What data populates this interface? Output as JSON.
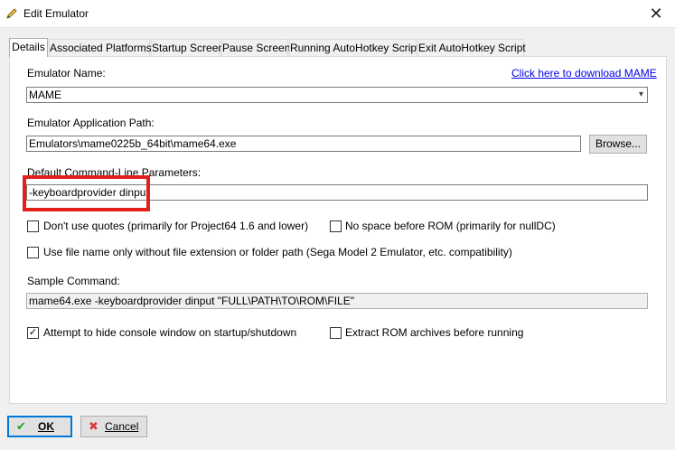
{
  "window": {
    "title": "Edit Emulator",
    "close_glyph": "✕",
    "icon": "pencil-icon"
  },
  "tabs": [
    {
      "label": "Details",
      "active": true
    },
    {
      "label": "Associated Platforms",
      "active": false
    },
    {
      "label": "Startup Screen",
      "active": false
    },
    {
      "label": "Pause Screen",
      "active": false
    },
    {
      "label": "Running AutoHotkey Script",
      "active": false
    },
    {
      "label": "Exit AutoHotkey Script",
      "active": false
    }
  ],
  "details": {
    "emulator_name_label": "Emulator Name:",
    "download_link": "Click here to download MAME",
    "emulator_name_value": "MAME",
    "app_path_label": "Emulator Application Path:",
    "app_path_value": "Emulators\\mame0225b_64bit\\mame64.exe",
    "browse_label": "Browse...",
    "cmd_params_label": "Default Command-Line Parameters:",
    "cmd_params_value": "-keyboardprovider dinput",
    "options": {
      "no_quotes": {
        "label": "Don't use quotes (primarily for Project64 1.6 and lower)",
        "checked": false
      },
      "no_space": {
        "label": "No space before ROM (primarily for nullDC)",
        "checked": false
      },
      "file_name_only": {
        "label": "Use file name only without file extension or folder path (Sega Model 2 Emulator, etc. compatibility)",
        "checked": false
      },
      "hide_console": {
        "label": "Attempt to hide console window on startup/shutdown",
        "checked": true
      },
      "extract_rom": {
        "label": "Extract ROM archives before running",
        "checked": false
      }
    },
    "sample_label": "Sample Command:",
    "sample_value": "mame64.exe -keyboardprovider dinput \"FULL\\PATH\\TO\\ROM\\FILE\""
  },
  "footer": {
    "ok_label": "OK",
    "cancel_label": "Cancel"
  },
  "colors": {
    "highlight": "#e3201b",
    "link": "#0000ee",
    "ok": "#2e9a2e",
    "cancel": "#d83b3b"
  }
}
